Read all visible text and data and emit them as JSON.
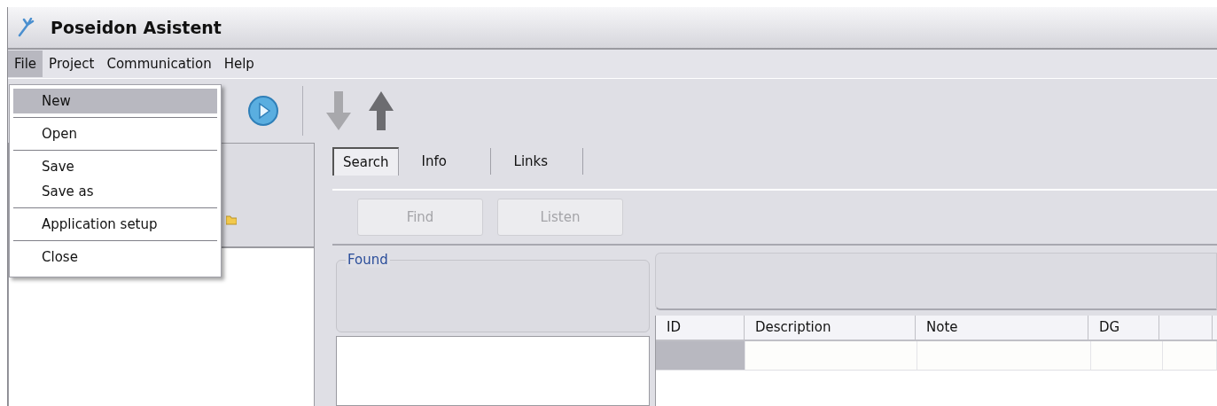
{
  "window": {
    "title": "Poseidon Asistent"
  },
  "menu_bar": [
    {
      "label": "File",
      "selected": true
    },
    {
      "label": "Project",
      "selected": false
    },
    {
      "label": "Communication",
      "selected": false
    },
    {
      "label": "Help",
      "selected": false
    }
  ],
  "file_menu": {
    "groups": [
      [
        {
          "label": "New",
          "selected": true
        }
      ],
      [
        {
          "label": "Open",
          "selected": false
        }
      ],
      [
        {
          "label": "Save",
          "selected": false
        },
        {
          "label": "Save as",
          "selected": false
        }
      ],
      [
        {
          "label": "Application setup",
          "selected": false
        }
      ],
      [
        {
          "label": "Close",
          "selected": false
        }
      ]
    ]
  },
  "tabs": [
    {
      "label": "Search",
      "selected": true
    },
    {
      "label": "Info",
      "selected": false
    },
    {
      "label": "Links",
      "selected": false
    }
  ],
  "buttons": [
    {
      "label": "Find",
      "disabled": true
    },
    {
      "label": "Listen",
      "disabled": true
    }
  ],
  "found_group": {
    "title": "Found"
  },
  "table": {
    "columns": [
      "ID",
      "Description",
      "Note",
      "DG"
    ]
  }
}
